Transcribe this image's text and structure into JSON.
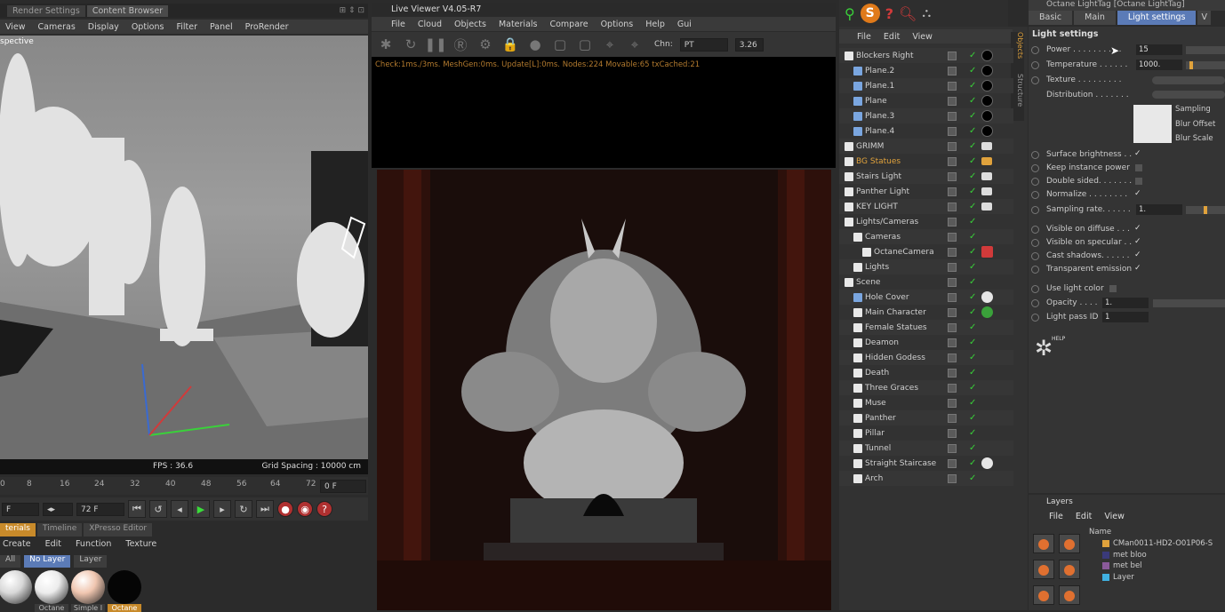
{
  "left_window": {
    "tabs": [
      "Render Settings",
      "Content Browser"
    ],
    "menu": [
      "View",
      "Cameras",
      "Display",
      "Options",
      "Filter",
      "Panel",
      "ProRender"
    ],
    "viewport_label": "spective",
    "fps": "FPS : 36.6",
    "grid_spacing": "Grid Spacing : 10000 cm"
  },
  "timeline": {
    "ticks": [
      "0",
      "8",
      "16",
      "24",
      "32",
      "40",
      "48",
      "56",
      "64",
      "72"
    ],
    "current_frame": "0 F",
    "start_field": "F",
    "end_field": "72 F"
  },
  "material_manager": {
    "tabs": [
      "terials",
      "Timeline",
      "XPresso Editor"
    ],
    "menu": [
      "Create",
      "Edit",
      "Function",
      "Texture"
    ],
    "filters": [
      "All",
      "No Layer",
      "Layer"
    ],
    "materials": [
      {
        "name": "",
        "color": "#d8d8d8"
      },
      {
        "name": "Octane",
        "color": "#ececec"
      },
      {
        "name": "Simple I",
        "color": "#f0c6b0"
      },
      {
        "name": "Octane",
        "color": "#050505"
      }
    ]
  },
  "live_viewer": {
    "title": "Live Viewer V4.05-R7",
    "menu": [
      "File",
      "Cloud",
      "Objects",
      "Materials",
      "Compare",
      "Options",
      "Help",
      "Gui"
    ],
    "channel_label": "Chn:",
    "channel_value": "PT",
    "zoom_value": "3.26",
    "status_line": "Check:1ms./3ms. MeshGen:0ms. Update[L]:0ms. Nodes:224 Movable:65 txCached:21"
  },
  "object_manager": {
    "menu": [
      "File",
      "Edit",
      "View"
    ],
    "side_tabs": [
      "Objects",
      "Structure"
    ],
    "rows": [
      {
        "name": "Blockers Right",
        "indent": 0,
        "highlight": false
      },
      {
        "name": "Plane.2",
        "indent": 1,
        "highlight": false
      },
      {
        "name": "Plane.1",
        "indent": 1,
        "highlight": false
      },
      {
        "name": "Plane",
        "indent": 1,
        "highlight": false
      },
      {
        "name": "Plane.3",
        "indent": 1,
        "highlight": false
      },
      {
        "name": "Plane.4",
        "indent": 1,
        "highlight": false
      },
      {
        "name": "GRIMM",
        "indent": 0,
        "highlight": false
      },
      {
        "name": "BG Statues",
        "indent": 0,
        "highlight": true
      },
      {
        "name": "Stairs Light",
        "indent": 0,
        "highlight": false
      },
      {
        "name": "Panther Light",
        "indent": 0,
        "highlight": false
      },
      {
        "name": "KEY LIGHT",
        "indent": 0,
        "highlight": false
      },
      {
        "name": "Lights/Cameras",
        "indent": 0,
        "highlight": false
      },
      {
        "name": "Cameras",
        "indent": 1,
        "highlight": false
      },
      {
        "name": "OctaneCamera",
        "indent": 2,
        "highlight": false
      },
      {
        "name": "Lights",
        "indent": 1,
        "highlight": false
      },
      {
        "name": "Scene",
        "indent": 0,
        "highlight": false
      },
      {
        "name": "Hole Cover",
        "indent": 1,
        "highlight": false
      },
      {
        "name": "Main Character",
        "indent": 1,
        "highlight": false
      },
      {
        "name": "Female Statues",
        "indent": 1,
        "highlight": false
      },
      {
        "name": "Deamon",
        "indent": 1,
        "highlight": false
      },
      {
        "name": "Hidden Godess",
        "indent": 1,
        "highlight": false
      },
      {
        "name": "Death",
        "indent": 1,
        "highlight": false
      },
      {
        "name": "Three Graces",
        "indent": 1,
        "highlight": false
      },
      {
        "name": "Muse",
        "indent": 1,
        "highlight": false
      },
      {
        "name": "Panther",
        "indent": 1,
        "highlight": false
      },
      {
        "name": "Pillar",
        "indent": 1,
        "highlight": false
      },
      {
        "name": "Tunnel",
        "indent": 1,
        "highlight": false
      },
      {
        "name": "Straight Staircase",
        "indent": 1,
        "highlight": false
      },
      {
        "name": "Arch",
        "indent": 1,
        "highlight": false
      }
    ]
  },
  "attribute_manager": {
    "title": "Octane LightTag [Octane LightTag]",
    "tabs": [
      "Basic",
      "Main",
      "Light settings",
      "V"
    ],
    "active_tab": "Light settings",
    "section": "Light settings",
    "power_label": "Power . . . . . . . . . .",
    "power_value": "15",
    "temperature_label": "Temperature . . . . . .",
    "temperature_value": "1000.",
    "texture_label": "Texture . . . . . . . . .",
    "distribution_label": "Distribution . . . . . . .",
    "sampling_label": "Sampling",
    "blur_offset_label": "Blur Offset",
    "blur_scale_label": "Blur Scale",
    "surface_brightness_label": "Surface brightness . .",
    "keep_instance_power_label": "Keep instance power",
    "double_sided_label": "Double sided. . . . . . .",
    "normalize_label": "Normalize . . . . . . . .",
    "sampling_rate_label": "Sampling rate. . . . . .",
    "sampling_rate_value": "1.",
    "visible_diffuse_label": "Visible on diffuse . . .",
    "visible_specular_label": "Visible on specular . .",
    "cast_shadows_label": "Cast shadows. . . . . .",
    "transparent_emission_label": "Transparent emission",
    "use_light_color_label": "Use light color",
    "opacity_label": "Opacity . . . .",
    "opacity_value": "1.",
    "light_pass_label": "Light pass ID",
    "light_pass_value": "1",
    "help_label": "HELP"
  },
  "layers": {
    "title": "Layers",
    "menu": [
      "File",
      "Edit",
      "View"
    ],
    "column_name": "Name",
    "items": [
      {
        "name": "CMan0011-HD2-O01P06-S",
        "color": "#e0a23c"
      },
      {
        "name": "met bloo",
        "color": "#3a3a7a"
      },
      {
        "name": "met bel",
        "color": "#8a5a9a"
      },
      {
        "name": "Layer",
        "color": "#40b0e0"
      }
    ]
  },
  "colors": {
    "accent": "#5b7bb7",
    "highlight_text": "#e0a23c",
    "check_green": "#39d039"
  }
}
